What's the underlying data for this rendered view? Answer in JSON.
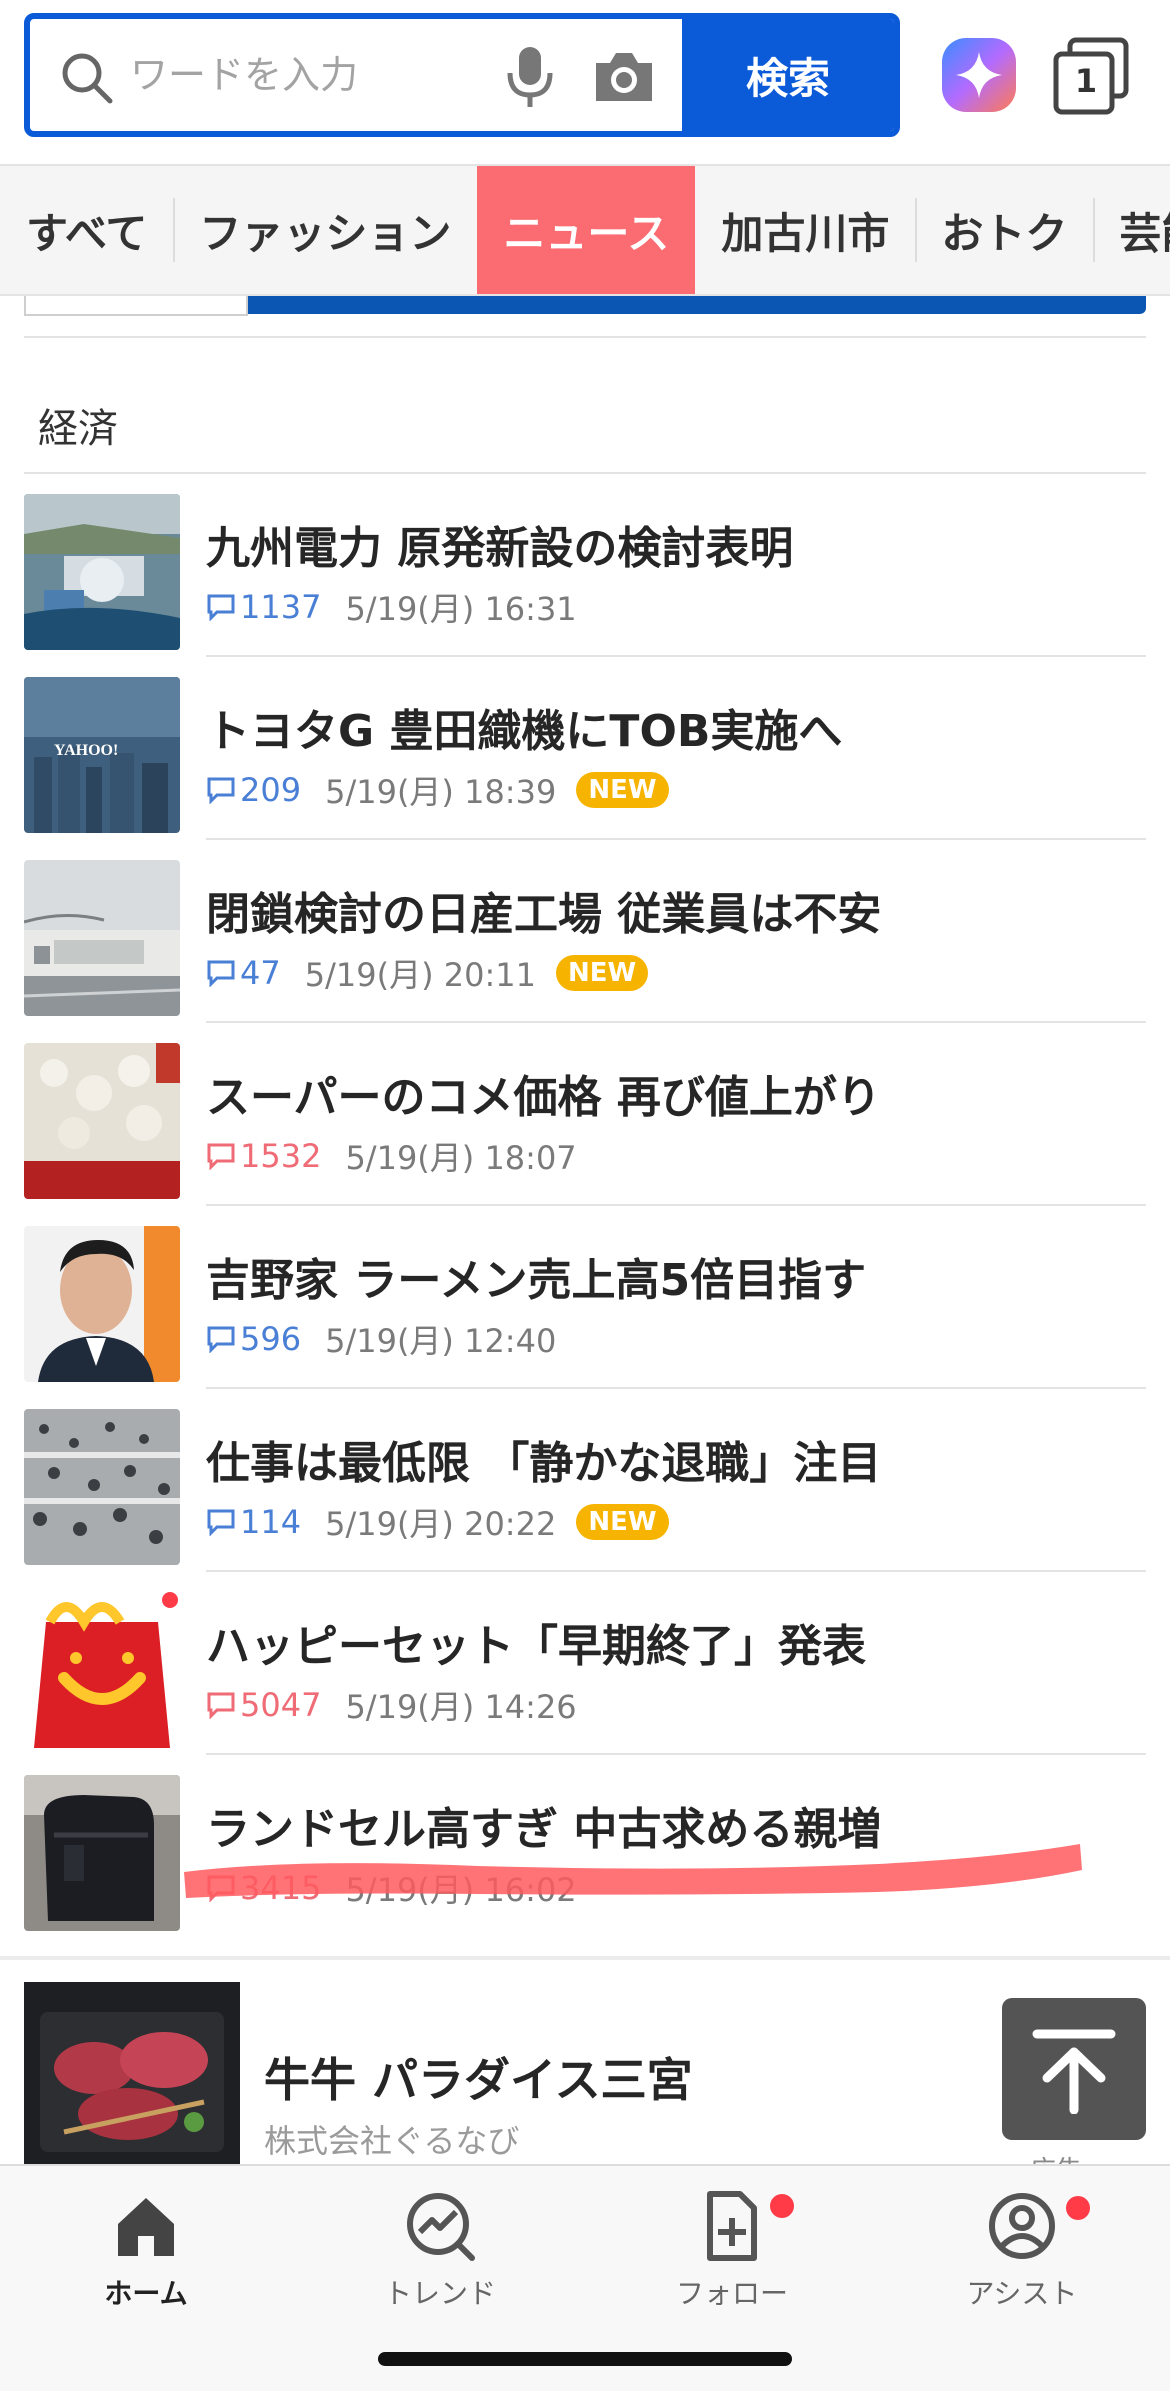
{
  "search": {
    "placeholder": "ワードを入力",
    "button_label": "検索",
    "tabs_count": "1"
  },
  "categories": [
    {
      "label": "すべて",
      "active": false
    },
    {
      "label": "ファッション",
      "active": false
    },
    {
      "label": "ニュース",
      "active": true
    },
    {
      "label": "加古川市",
      "active": false
    },
    {
      "label": "おトク",
      "active": false
    },
    {
      "label": "芸能",
      "active": false
    }
  ],
  "section": {
    "title": "経済"
  },
  "news": [
    {
      "title": "九州電力 原発新設の検討表明",
      "comments": "1137",
      "comment_color": "blue",
      "date": "5/19(月) 16:31",
      "badge": "",
      "thumb": "power-plant"
    },
    {
      "title": "トヨタG 豊田織機にTOB実施へ",
      "comments": "209",
      "comment_color": "blue",
      "date": "5/19(月) 18:39",
      "badge": "NEW",
      "thumb": "yahoo-city"
    },
    {
      "title": "閉鎖検討の日産工場 従業員は不安",
      "comments": "47",
      "comment_color": "blue",
      "date": "5/19(月) 20:11",
      "badge": "NEW",
      "thumb": "factory"
    },
    {
      "title": "スーパーのコメ価格 再び値上がり",
      "comments": "1532",
      "comment_color": "red",
      "date": "5/19(月) 18:07",
      "badge": "",
      "thumb": "rice"
    },
    {
      "title": "吉野家 ラーメン売上高5倍目指す",
      "comments": "596",
      "comment_color": "blue",
      "date": "5/19(月) 12:40",
      "badge": "",
      "thumb": "person"
    },
    {
      "title": "仕事は最低限 「静かな退職」注目",
      "comments": "114",
      "comment_color": "blue",
      "date": "5/19(月) 20:22",
      "badge": "NEW",
      "thumb": "crowd"
    },
    {
      "title": "ハッピーセット「早期終了」発表",
      "comments": "5047",
      "comment_color": "red",
      "date": "5/19(月) 14:26",
      "badge": "",
      "thumb": "happy-meal"
    },
    {
      "title": "ランドセル高すぎ 中古求める親増",
      "comments": "3415",
      "comment_color": "red",
      "date": "5/19(月) 16:02",
      "badge": "",
      "thumb": "randoseru"
    }
  ],
  "ad": {
    "title": "牛牛 パラダイス三宮",
    "sponsor": "株式会社ぐるなび",
    "label": "広告"
  },
  "bottom_nav": [
    {
      "label": "ホーム",
      "icon": "home-icon",
      "active": true
    },
    {
      "label": "トレンド",
      "icon": "trend-icon",
      "active": false
    },
    {
      "label": "フォロー",
      "icon": "follow-icon",
      "active": false
    },
    {
      "label": "アシスト",
      "icon": "assist-icon",
      "active": false
    }
  ],
  "colors": {
    "brand_blue": "#0b5bd9",
    "active_tab": "#fb6b72",
    "new_badge": "#f6b400",
    "comment_blue": "#4a7fd6",
    "comment_red": "#ef6b75",
    "notification_dot": "#ff3b48"
  }
}
